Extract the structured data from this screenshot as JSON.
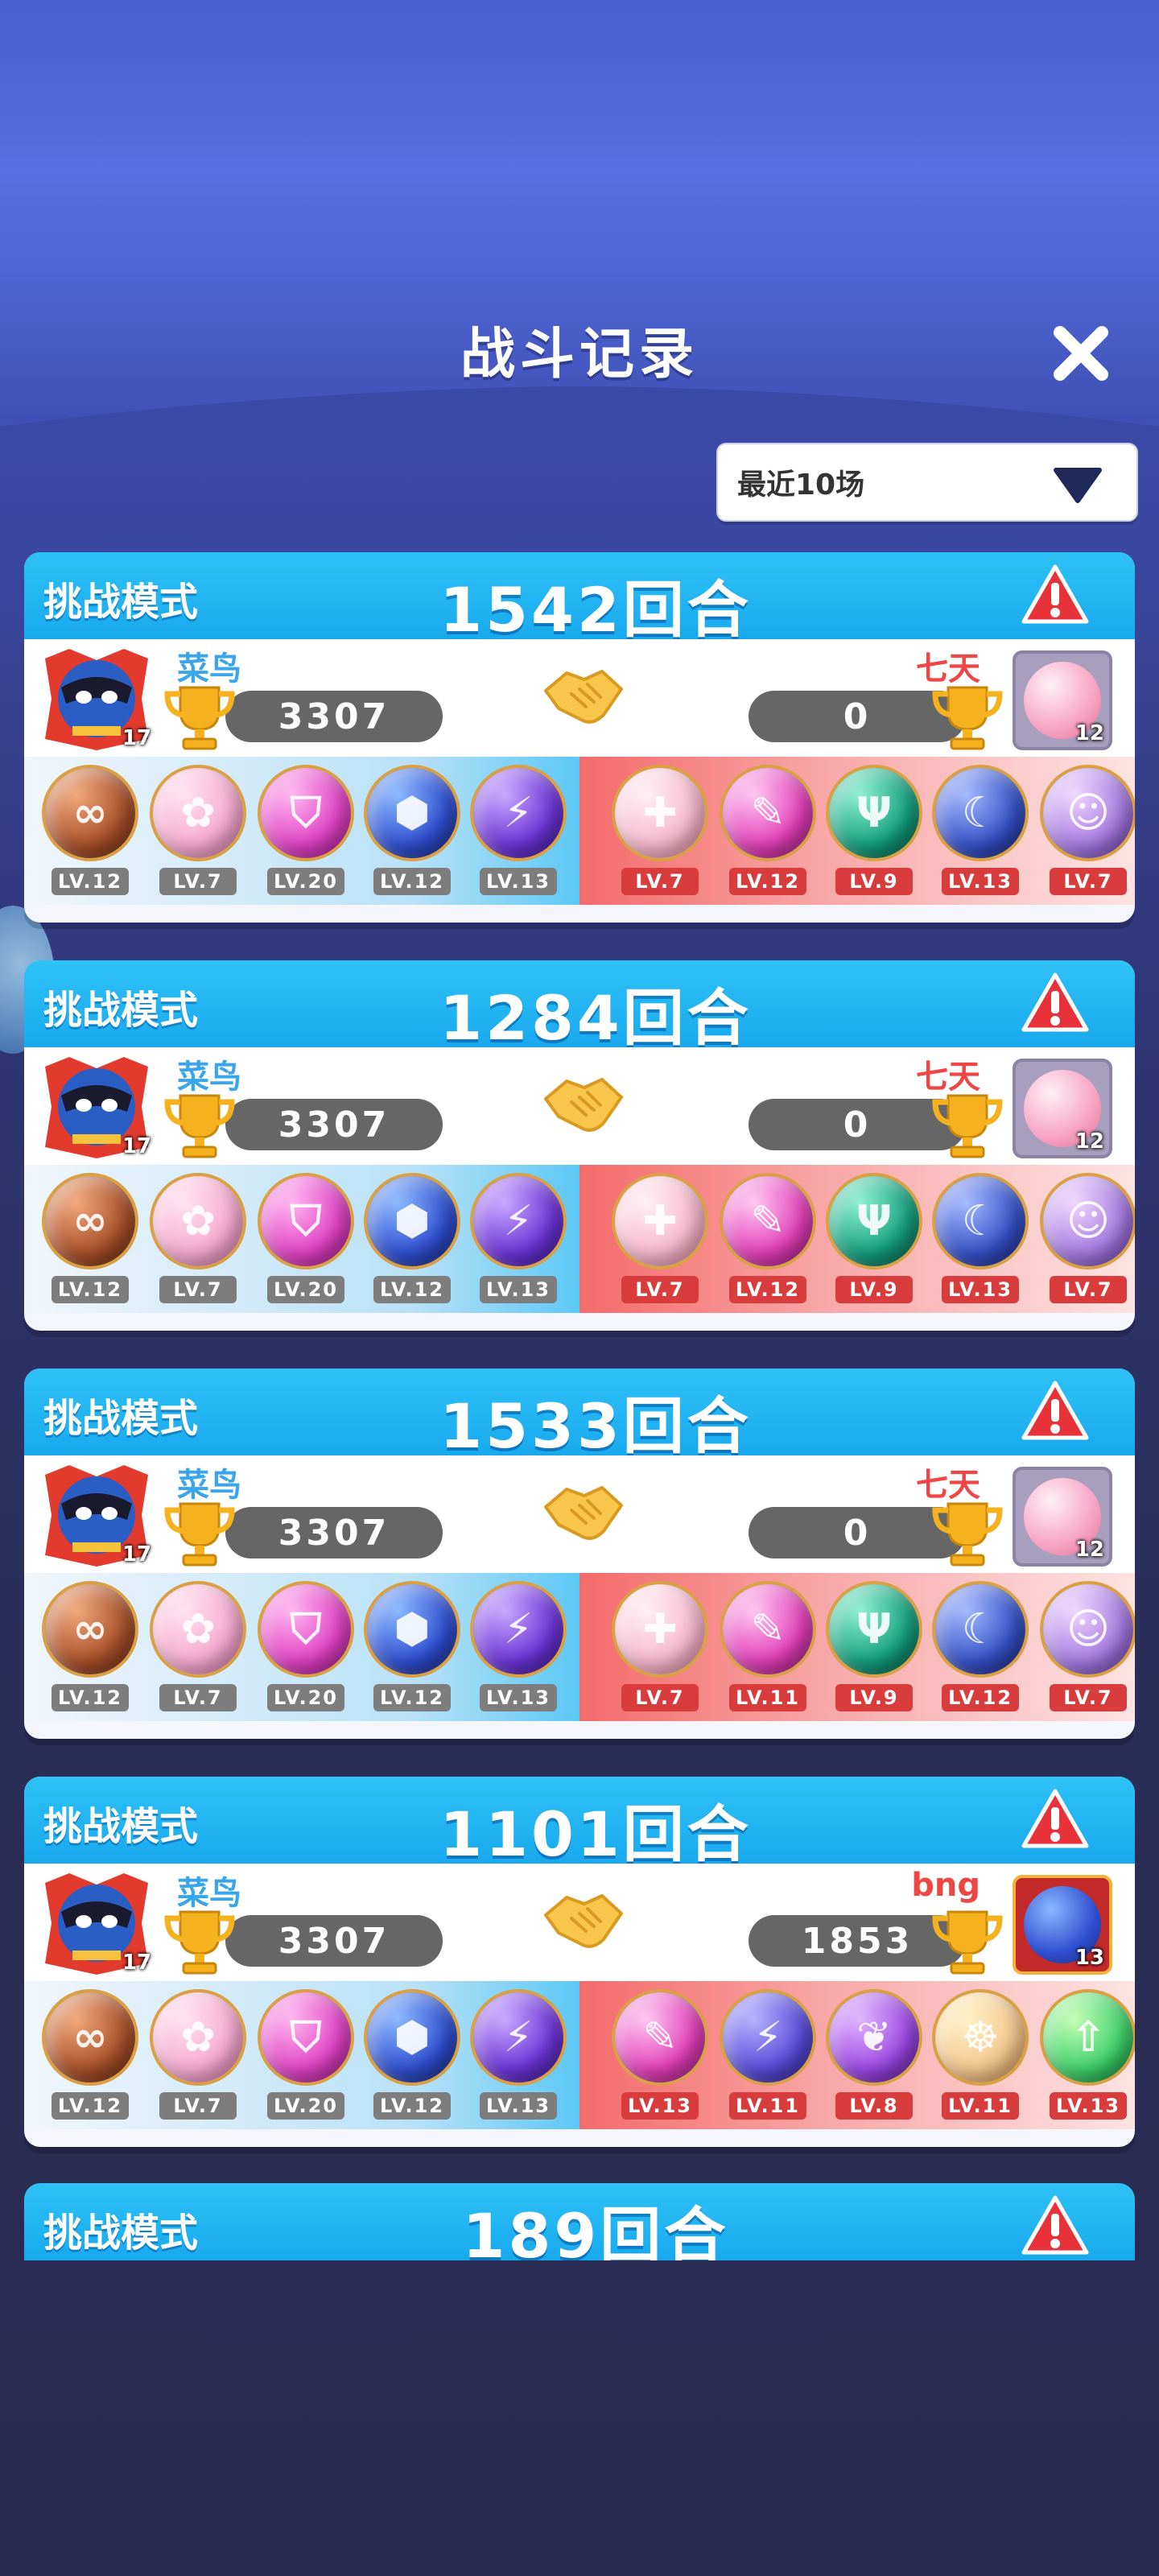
{
  "screen": {
    "title": "战斗记录",
    "filter_selected": "最近10场"
  },
  "colors": {
    "header_blue": "#18a9ee",
    "player_name": "#3aa5ea",
    "opponent_name": "#f04545",
    "level_badge_self": "#7d7d7d",
    "level_badge_opponent": "#d93c3c"
  },
  "records": [
    {
      "mode": "挑战模式",
      "rounds": "1542回合",
      "player": {
        "name": "菜鸟",
        "score": "3307",
        "avatar_level": "17"
      },
      "opponent": {
        "name": "七天",
        "score": "0",
        "avatar_level": "12",
        "avatar_icon": "pink-orb-avatar"
      },
      "player_team": [
        {
          "icon": "infinity-orb",
          "color": "bronze",
          "glyph": "∞",
          "level": "LV.12"
        },
        {
          "icon": "pink-bloom-orb",
          "color": "pink",
          "glyph": "✿",
          "level": "LV.7"
        },
        {
          "icon": "shield-orb",
          "color": "magenta",
          "glyph": "⛉",
          "level": "LV.20"
        },
        {
          "icon": "hex-orb",
          "color": "blue",
          "glyph": "⬢",
          "level": "LV.12"
        },
        {
          "icon": "lightning-orb",
          "color": "violet",
          "glyph": "⚡",
          "level": "LV.13"
        }
      ],
      "opponent_team": [
        {
          "icon": "cross-orb",
          "color": "rose",
          "glyph": "✚",
          "level": "LV.7"
        },
        {
          "icon": "feather-orb",
          "color": "fuchsia",
          "glyph": "✎",
          "level": "LV.12"
        },
        {
          "icon": "trident-orb",
          "color": "teal",
          "glyph": "Ψ",
          "level": "LV.9"
        },
        {
          "icon": "crescent-orb",
          "color": "navy",
          "glyph": "☾",
          "level": "LV.13"
        },
        {
          "icon": "girl-orb",
          "color": "lilac",
          "glyph": "☺",
          "level": "LV.7"
        }
      ]
    },
    {
      "mode": "挑战模式",
      "rounds": "1284回合",
      "player": {
        "name": "菜鸟",
        "score": "3307",
        "avatar_level": "17"
      },
      "opponent": {
        "name": "七天",
        "score": "0",
        "avatar_level": "12",
        "avatar_icon": "pink-orb-avatar"
      },
      "player_team": [
        {
          "icon": "infinity-orb",
          "color": "bronze",
          "glyph": "∞",
          "level": "LV.12"
        },
        {
          "icon": "pink-bloom-orb",
          "color": "pink",
          "glyph": "✿",
          "level": "LV.7"
        },
        {
          "icon": "shield-orb",
          "color": "magenta",
          "glyph": "⛉",
          "level": "LV.20"
        },
        {
          "icon": "hex-orb",
          "color": "blue",
          "glyph": "⬢",
          "level": "LV.12"
        },
        {
          "icon": "lightning-orb",
          "color": "violet",
          "glyph": "⚡",
          "level": "LV.13"
        }
      ],
      "opponent_team": [
        {
          "icon": "cross-orb",
          "color": "rose",
          "glyph": "✚",
          "level": "LV.7"
        },
        {
          "icon": "feather-orb",
          "color": "fuchsia",
          "glyph": "✎",
          "level": "LV.12"
        },
        {
          "icon": "trident-orb",
          "color": "teal",
          "glyph": "Ψ",
          "level": "LV.9"
        },
        {
          "icon": "crescent-orb",
          "color": "navy",
          "glyph": "☾",
          "level": "LV.13"
        },
        {
          "icon": "girl-orb",
          "color": "lilac",
          "glyph": "☺",
          "level": "LV.7"
        }
      ]
    },
    {
      "mode": "挑战模式",
      "rounds": "1533回合",
      "player": {
        "name": "菜鸟",
        "score": "3307",
        "avatar_level": "17"
      },
      "opponent": {
        "name": "七天",
        "score": "0",
        "avatar_level": "12",
        "avatar_icon": "pink-orb-avatar"
      },
      "player_team": [
        {
          "icon": "infinity-orb",
          "color": "bronze",
          "glyph": "∞",
          "level": "LV.12"
        },
        {
          "icon": "pink-bloom-orb",
          "color": "pink",
          "glyph": "✿",
          "level": "LV.7"
        },
        {
          "icon": "shield-orb",
          "color": "magenta",
          "glyph": "⛉",
          "level": "LV.20"
        },
        {
          "icon": "hex-orb",
          "color": "blue",
          "glyph": "⬢",
          "level": "LV.12"
        },
        {
          "icon": "lightning-orb",
          "color": "violet",
          "glyph": "⚡",
          "level": "LV.13"
        }
      ],
      "opponent_team": [
        {
          "icon": "cross-orb",
          "color": "rose",
          "glyph": "✚",
          "level": "LV.7"
        },
        {
          "icon": "feather-orb",
          "color": "fuchsia",
          "glyph": "✎",
          "level": "LV.11"
        },
        {
          "icon": "trident-orb",
          "color": "teal",
          "glyph": "Ψ",
          "level": "LV.9"
        },
        {
          "icon": "crescent-orb",
          "color": "navy",
          "glyph": "☾",
          "level": "LV.12"
        },
        {
          "icon": "girl-orb",
          "color": "lilac",
          "glyph": "☺",
          "level": "LV.7"
        }
      ]
    },
    {
      "mode": "挑战模式",
      "rounds": "1101回合",
      "player": {
        "name": "菜鸟",
        "score": "3307",
        "avatar_level": "17"
      },
      "opponent": {
        "name": "bng",
        "score": "1853",
        "avatar_level": "13",
        "avatar_icon": "hex-orb-avatar"
      },
      "player_team": [
        {
          "icon": "infinity-orb",
          "color": "bronze",
          "glyph": "∞",
          "level": "LV.12"
        },
        {
          "icon": "pink-bloom-orb",
          "color": "pink",
          "glyph": "✿",
          "level": "LV.7"
        },
        {
          "icon": "shield-orb",
          "color": "magenta",
          "glyph": "⛉",
          "level": "LV.20"
        },
        {
          "icon": "hex-orb",
          "color": "blue",
          "glyph": "⬢",
          "level": "LV.12"
        },
        {
          "icon": "lightning-orb",
          "color": "violet",
          "glyph": "⚡",
          "level": "LV.13"
        }
      ],
      "opponent_team": [
        {
          "icon": "feather-orb",
          "color": "fuchsia",
          "glyph": "✎",
          "level": "LV.13"
        },
        {
          "icon": "lightning-orb",
          "color": "indigo",
          "glyph": "⚡",
          "level": "LV.11"
        },
        {
          "icon": "butterfly-orb",
          "color": "purple",
          "glyph": "❦",
          "level": "LV.8"
        },
        {
          "icon": "squid-orb",
          "color": "peach",
          "glyph": "☸",
          "level": "LV.11"
        },
        {
          "icon": "up-arrow-orb",
          "color": "green",
          "glyph": "⇧",
          "level": "LV.13"
        }
      ]
    }
  ],
  "partial_record": {
    "mode": "挑战模式",
    "rounds": "189回合"
  }
}
